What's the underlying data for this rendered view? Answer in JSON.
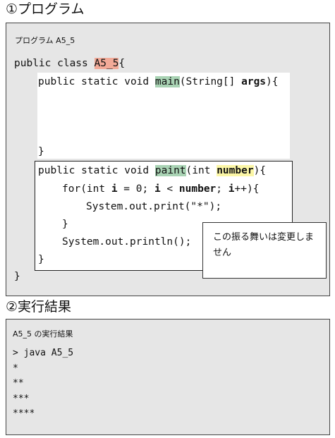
{
  "section1": {
    "heading": "①プログラム"
  },
  "program": {
    "caption": "プログラム A5_5",
    "class_line": {
      "prefix": "public class ",
      "class_name": "A5_5",
      "suffix": "{"
    },
    "main_line": {
      "prefix": "public static void ",
      "method": "main",
      "params_start": "(String[] ",
      "param": "args",
      "suffix": "){"
    },
    "main_close": "}",
    "paint_line": {
      "prefix": "public static void ",
      "method": "paint",
      "params_start": "(int ",
      "param": "number",
      "suffix": "){"
    },
    "for_line": {
      "t1": "for(int ",
      "v1": "i",
      "t2": " = 0; ",
      "v2": "i",
      "t3": " < ",
      "v3": "number",
      "t4": "; ",
      "v4": "i",
      "t5": "++){"
    },
    "print_line": "System.out.print(\"*\");",
    "for_close": "}",
    "println_line": "System.out.println();",
    "paint_close": "}",
    "class_close": "}",
    "note": "この振る舞いは変更しません"
  },
  "section2": {
    "heading": "②実行結果"
  },
  "result": {
    "caption": "A5_5 の実行結果",
    "lines": [
      "> java A5_5",
      "*",
      "**",
      "***",
      "****"
    ]
  },
  "colors": {
    "class_highlight": "#f2aa98",
    "method_highlight": "#a9d3b4",
    "param_highlight": "#fbf6a6",
    "panel_bg": "#e6e6e6"
  }
}
